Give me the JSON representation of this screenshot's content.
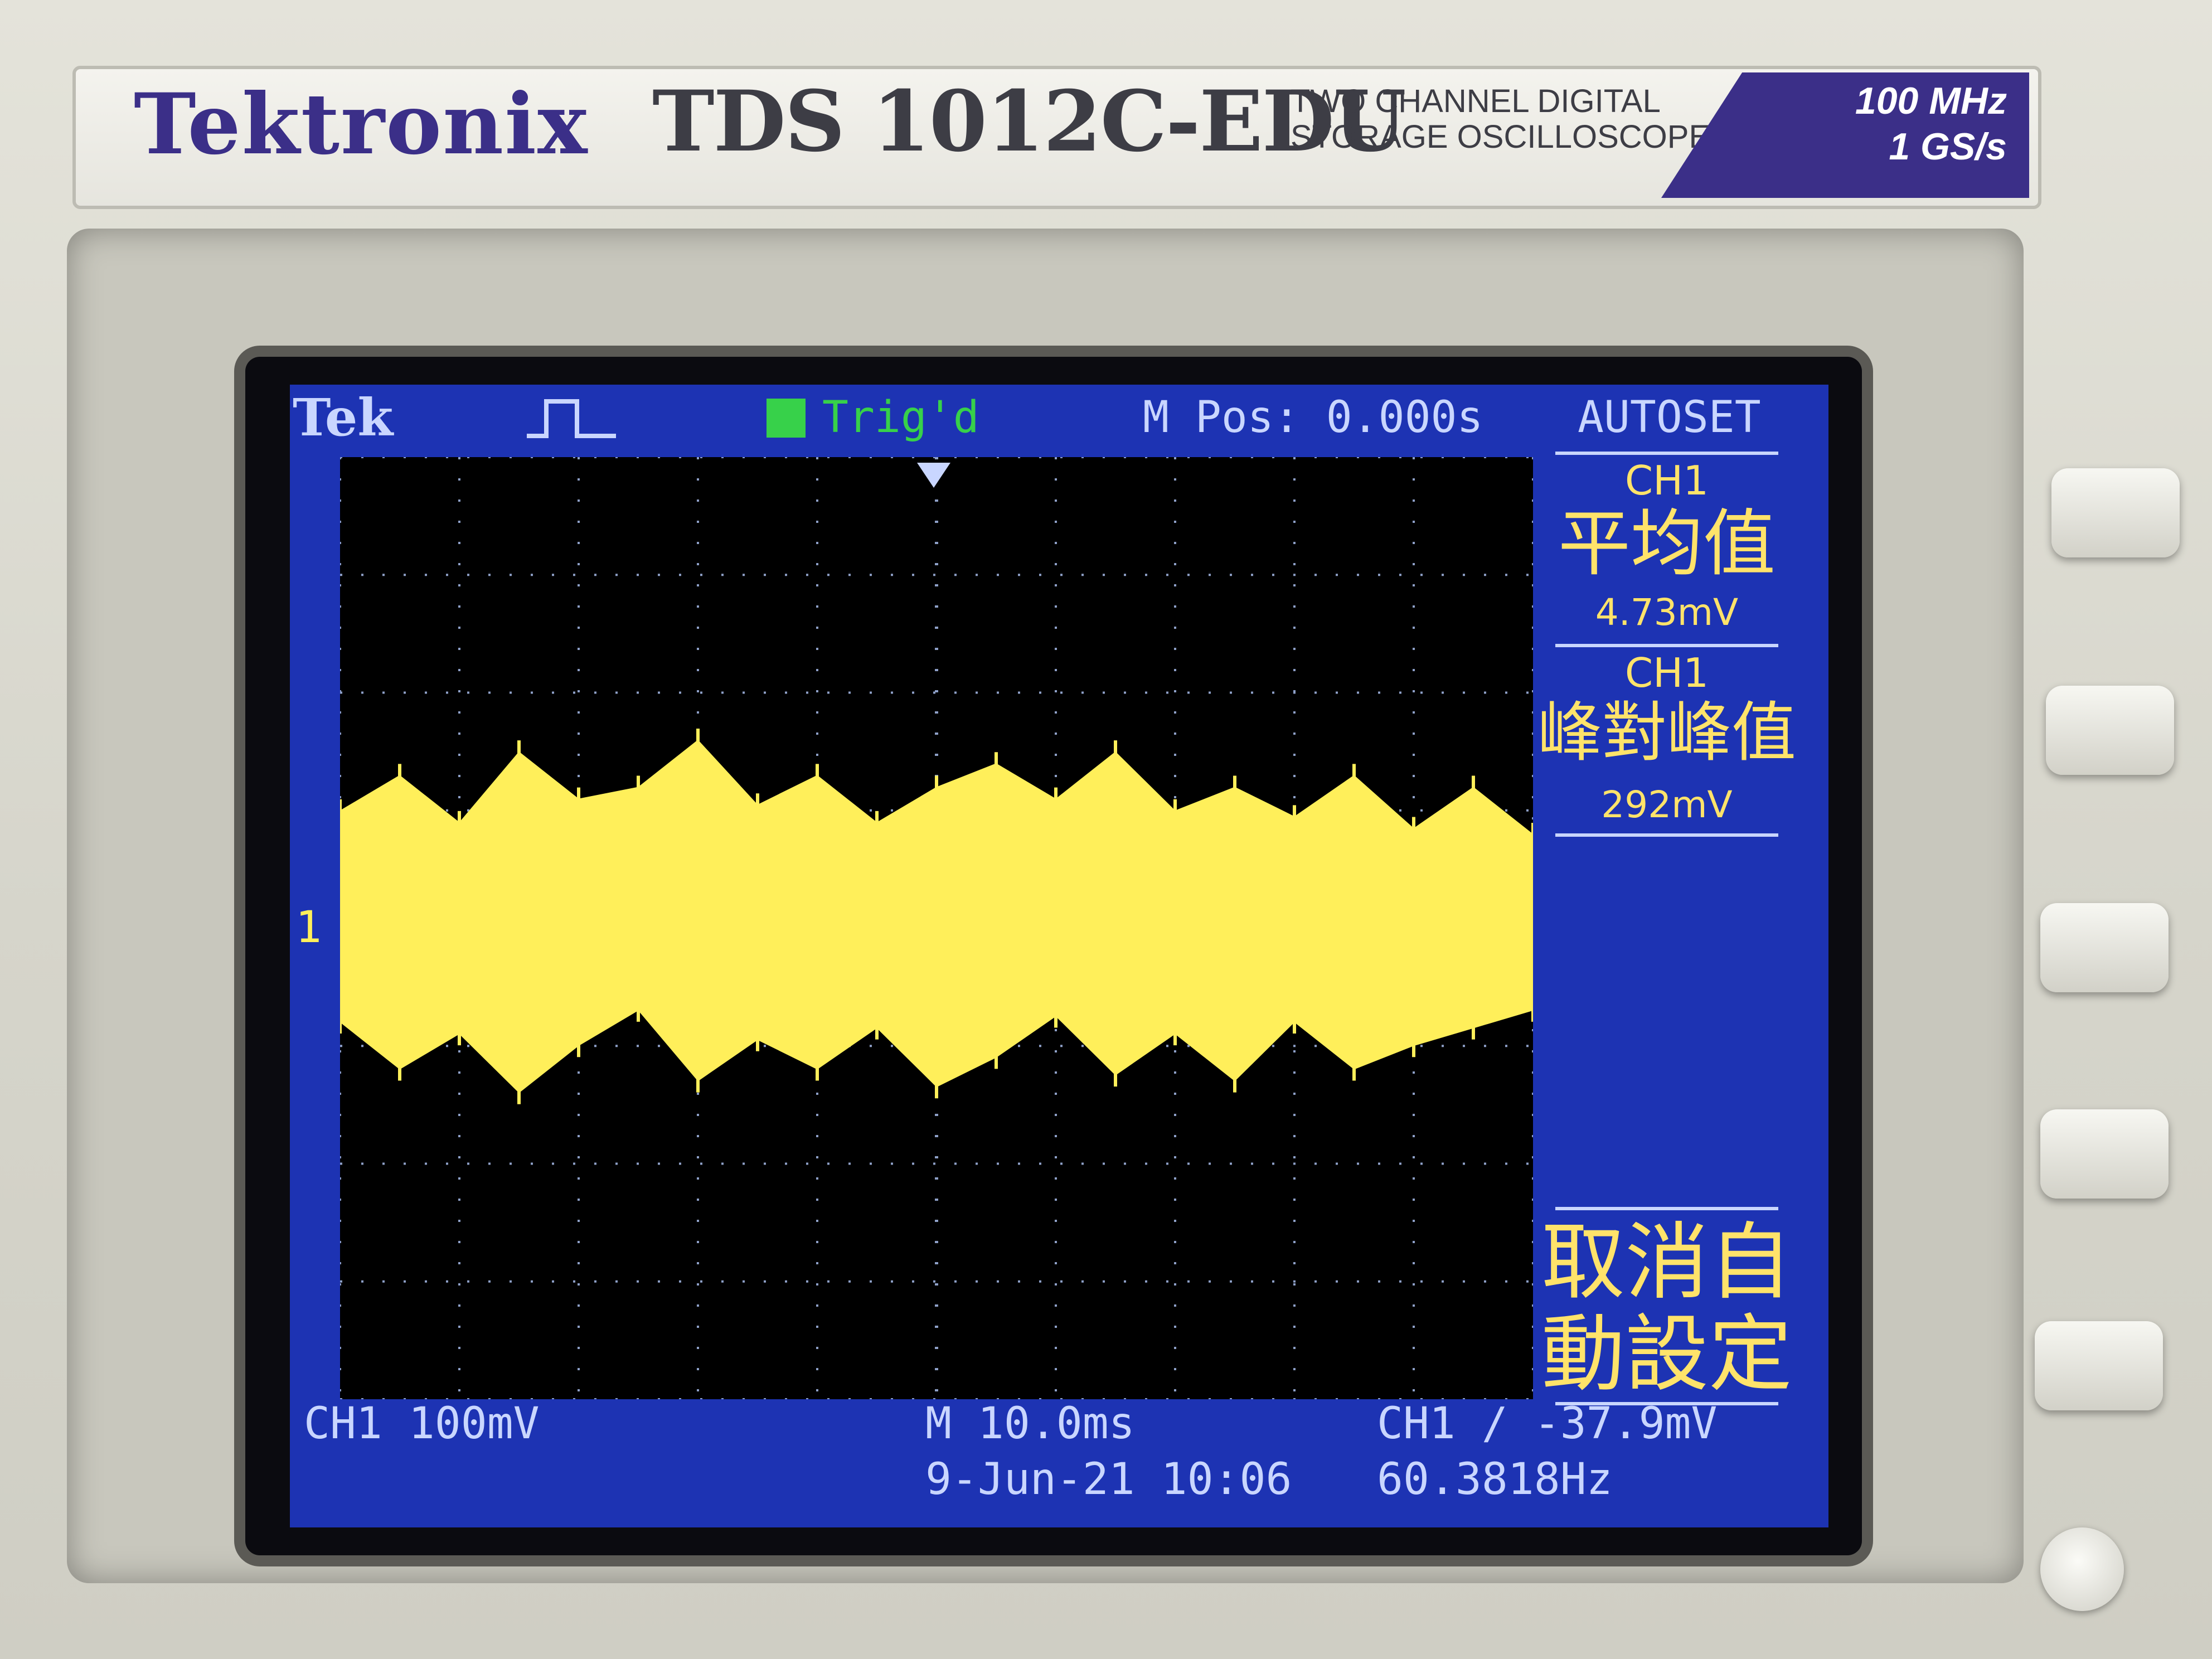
{
  "device": {
    "brand": "Tektronix",
    "model": "TDS 1012C-EDU",
    "description_line1": "TWO CHANNEL DIGITAL",
    "description_line2": "STORAGE OSCILLOSCOPE",
    "bandwidth": "100 MHz",
    "sample_rate": "1 GS/s"
  },
  "top_bar": {
    "logo": "Tek",
    "trigger_status": "Trig'd",
    "position": "M Pos: 0.000s",
    "mode": "AUTOSET"
  },
  "side_menu": [
    {
      "channel": "CH1",
      "label": "平均值",
      "value": "4.73mV"
    },
    {
      "channel": "CH1",
      "label": "峰對峰值",
      "value": "292mV"
    },
    {
      "channel": "",
      "label": "取消自",
      "value": "動設定"
    }
  ],
  "bottom_bar": {
    "ch_scale": "CH1  100mV",
    "timebase": "M 10.0ms",
    "datetime": "9-Jun-21 10:06",
    "trigger": "CH1 ∕ -37.9mV",
    "frequency": "60.3818Hz"
  },
  "marker": "1",
  "trace_color": "#ffef5a",
  "grid_color": "#8ea0c8",
  "chart_data": {
    "type": "line",
    "title": "",
    "xlabel": "",
    "ylabel": "",
    "xlim": [
      -50,
      50
    ],
    "ylim": [
      -400,
      400
    ],
    "grid": true,
    "series": [
      {
        "name": "",
        "x": [
          -50,
          -45,
          -40,
          -35,
          -30,
          -25,
          -20,
          -15,
          -10,
          -5,
          0,
          5,
          10,
          15,
          20,
          25,
          30,
          35,
          40,
          45,
          50
        ],
        "min": [
          -80,
          -120,
          -90,
          -140,
          -100,
          -70,
          -130,
          -95,
          -120,
          -85,
          -135,
          -110,
          -75,
          -125,
          -90,
          -130,
          -80,
          -120,
          -100,
          -85,
          -70
        ],
        "max": [
          100,
          130,
          90,
          150,
          110,
          120,
          160,
          105,
          130,
          90,
          120,
          140,
          110,
          150,
          100,
          120,
          95,
          130,
          85,
          120,
          80
        ]
      }
    ]
  }
}
